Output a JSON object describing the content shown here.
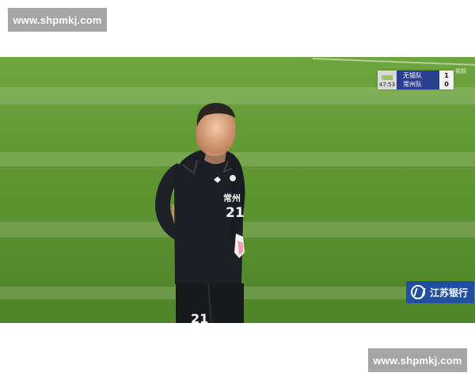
{
  "watermarks": {
    "top": "www.shpmkj.com",
    "bottom": "www.shpmkj.com"
  },
  "scoreboard": {
    "time": "47:53",
    "home_team": "无锡队",
    "away_team": "常州队",
    "home_score": "1",
    "away_score": "0"
  },
  "player": {
    "shirt_team_text": "常州",
    "chest_number": "21",
    "shorts_number": "21"
  },
  "sponsor": {
    "name": "江苏银行"
  },
  "broadcast_mark": "视频",
  "colors": {
    "pitch": "#5d8d2f",
    "pitch_light": "#6e9f3d",
    "kit": "#1c1f25",
    "sponsor": "#1f4ea3",
    "scoreboard_blue": "#2b3f8f"
  }
}
